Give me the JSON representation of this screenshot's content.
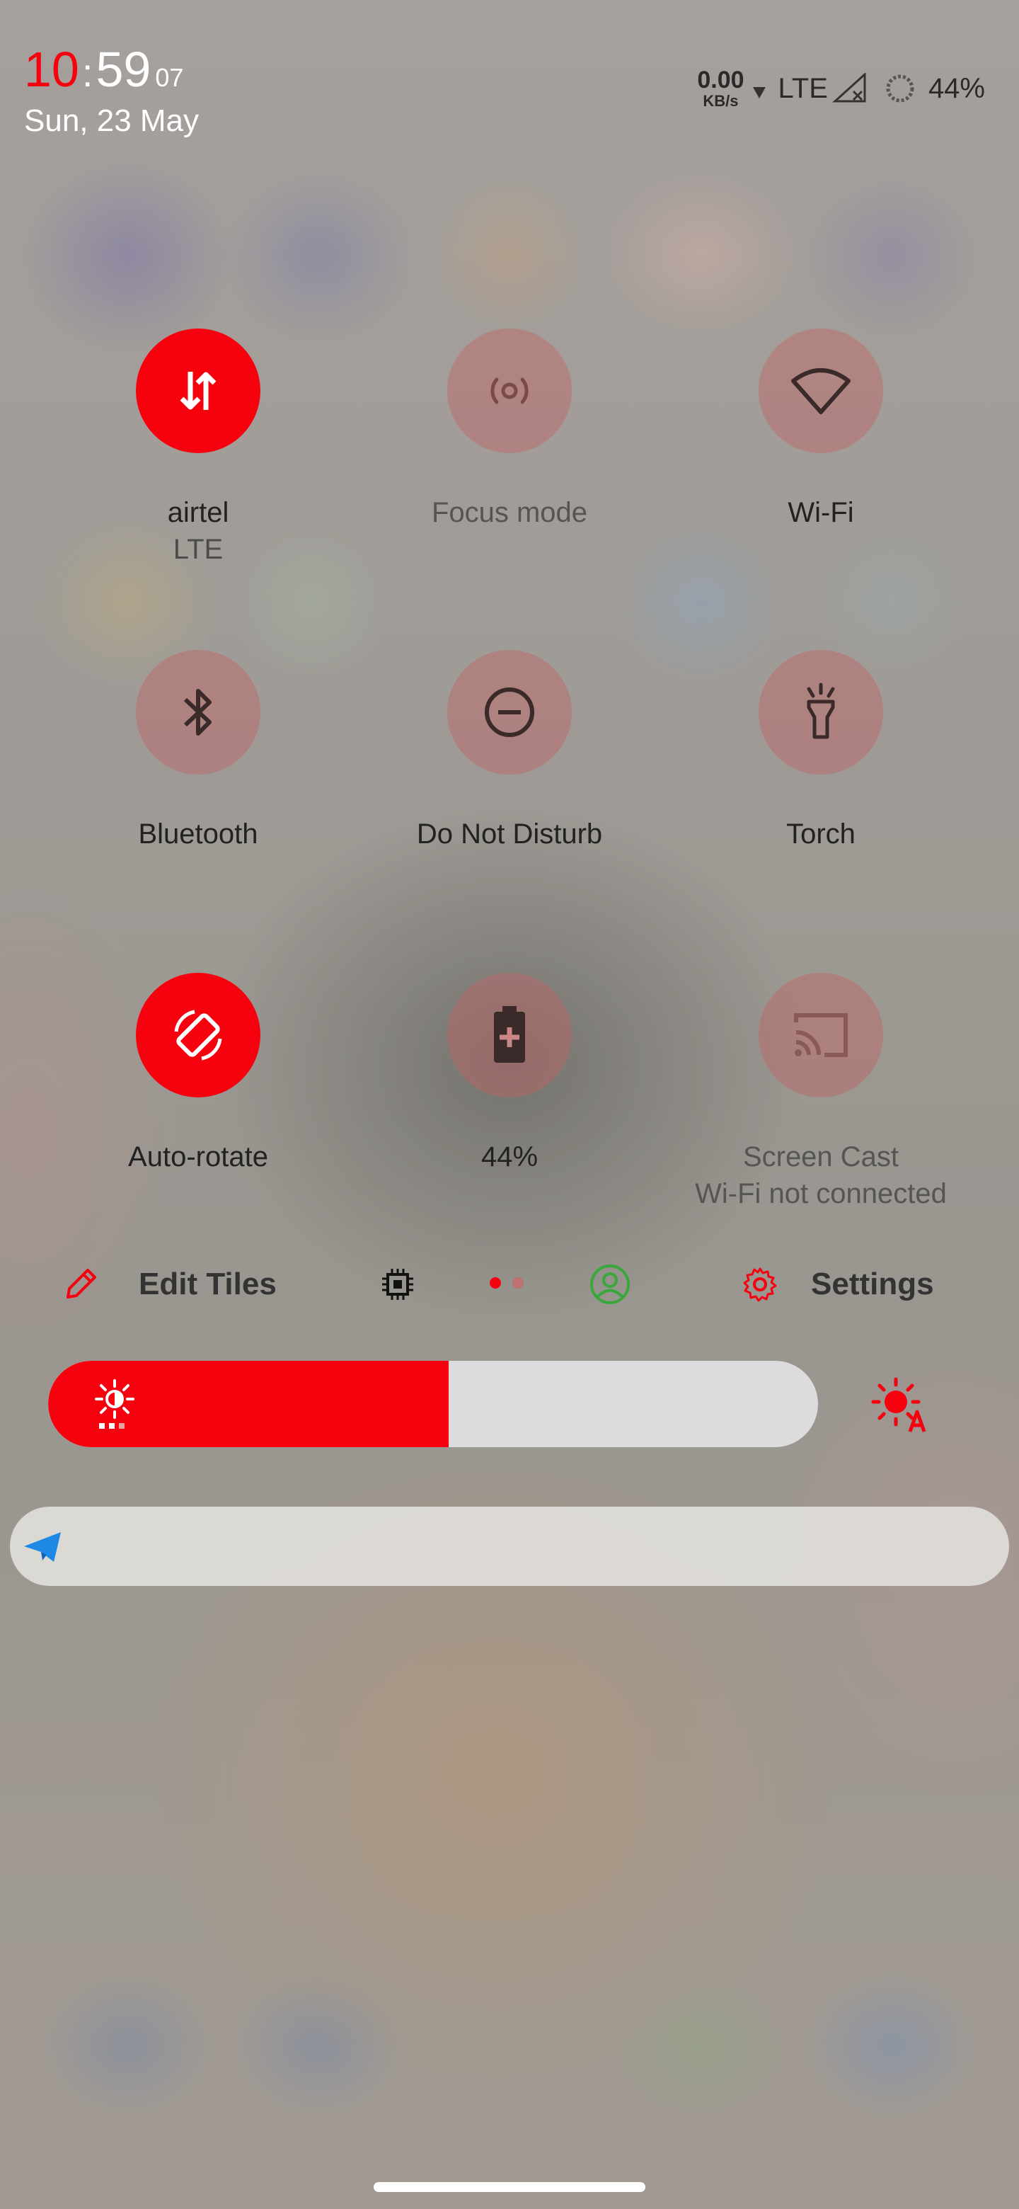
{
  "status_bar": {
    "clock_hour": "10",
    "clock_sep": ":",
    "clock_minute": "59",
    "clock_second": "07",
    "date": "Sun, 23 May",
    "net_speed": "0.00",
    "net_speed_unit": "KB/s",
    "network_type": "LTE",
    "battery_percent": "44%"
  },
  "tiles": [
    {
      "label": "airtel",
      "sub": "LTE",
      "icon": "mobile-data-icon",
      "active": true
    },
    {
      "label": "Focus mode",
      "sub": "",
      "icon": "focus-mode-icon",
      "active": false
    },
    {
      "label": "Wi-Fi",
      "sub": "",
      "icon": "wifi-icon",
      "active": false
    },
    {
      "label": "Bluetooth",
      "sub": "",
      "icon": "bluetooth-icon",
      "active": false
    },
    {
      "label": "Do Not Disturb",
      "sub": "",
      "icon": "do-not-disturb-icon",
      "active": false
    },
    {
      "label": "Torch",
      "sub": "",
      "icon": "torch-icon",
      "active": false
    },
    {
      "label": "Auto-rotate",
      "sub": "",
      "icon": "auto-rotate-icon",
      "active": true
    },
    {
      "label": "44%",
      "sub": "",
      "icon": "battery-saver-icon",
      "active": false
    },
    {
      "label": "Screen Cast",
      "sub": "Wi-Fi not connected",
      "icon": "screen-cast-icon",
      "active": false
    }
  ],
  "footer": {
    "edit_label": "Edit Tiles",
    "settings_label": "Settings",
    "page_count": 2,
    "current_page": 1
  },
  "brightness": {
    "level": 0.52
  },
  "colors": {
    "accent": "#f5020e",
    "inactive_tile": "#be6464",
    "user_icon": "#3aa73a",
    "send_icon": "#1e88e5"
  }
}
